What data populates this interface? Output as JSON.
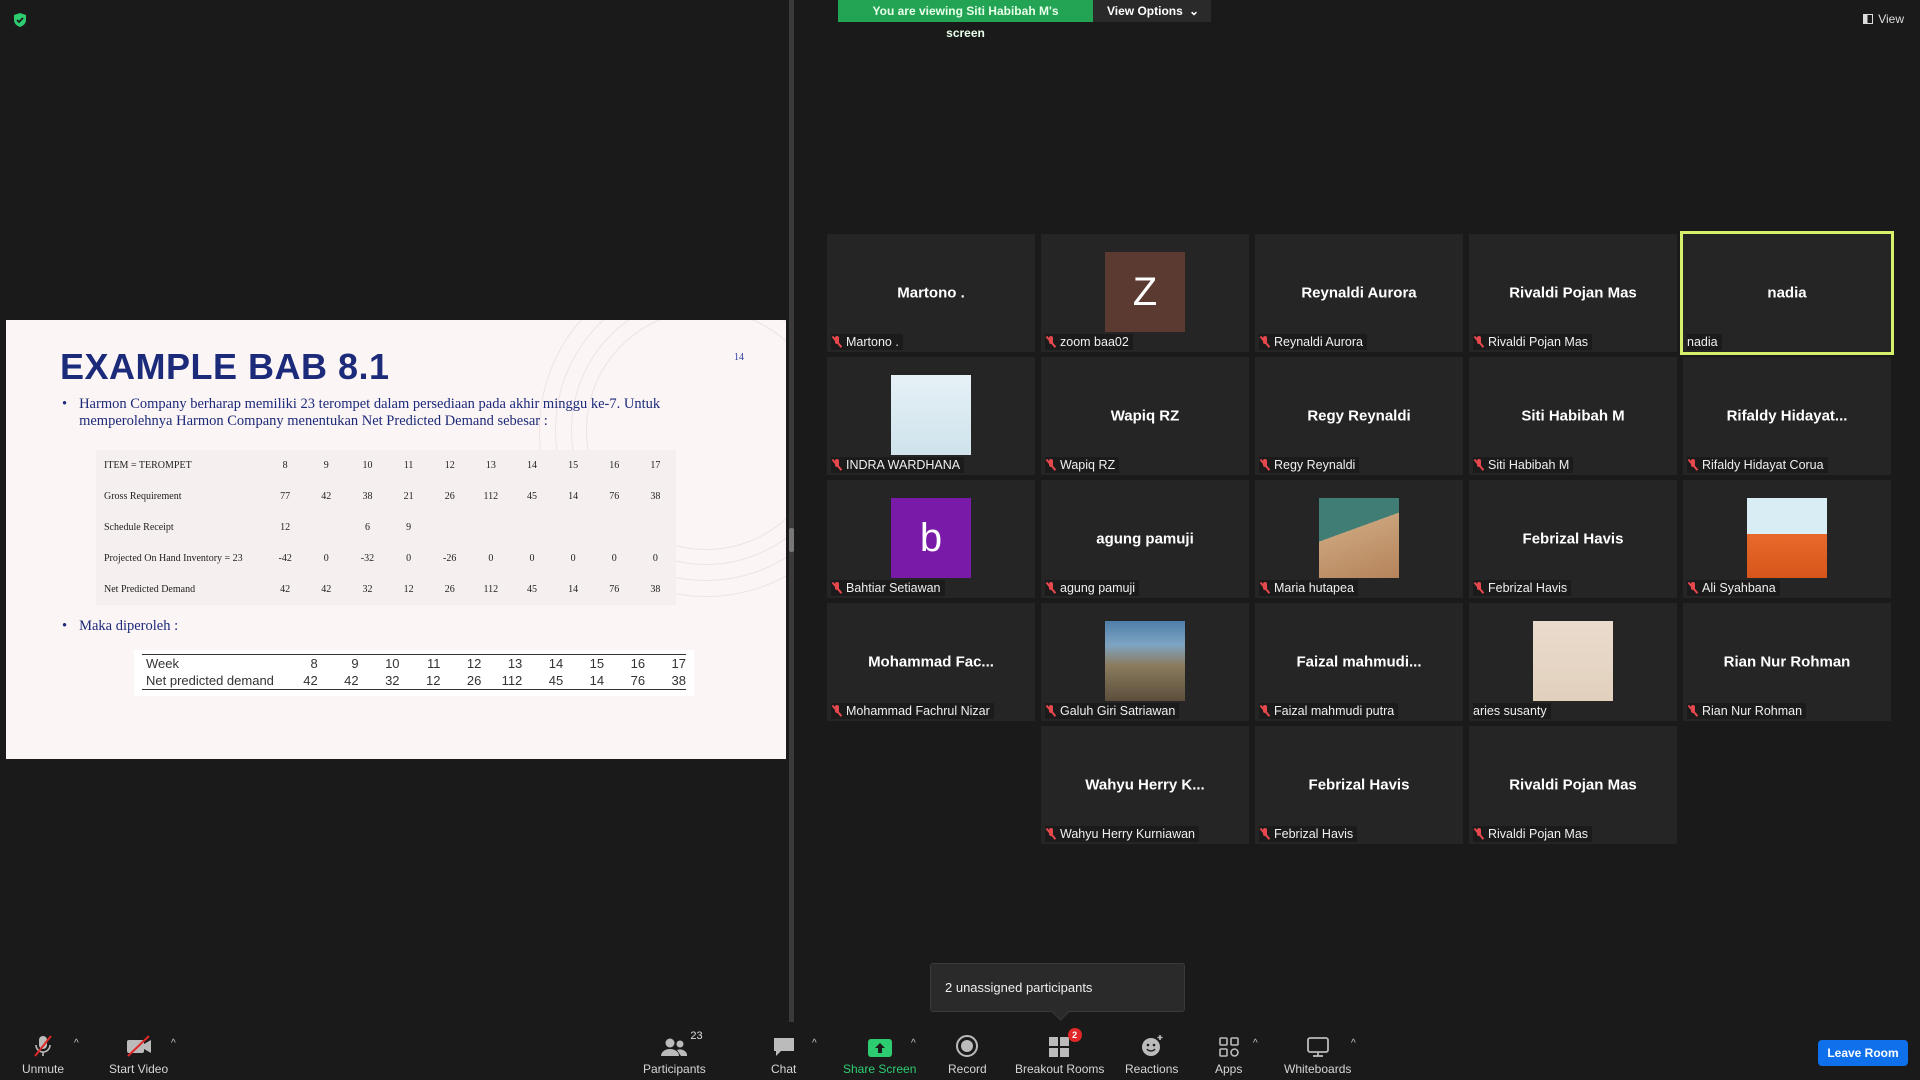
{
  "banner": {
    "viewing": "You are viewing Siti Habibah M's screen",
    "view_options": "View Options",
    "chevron": "⌄"
  },
  "view_button": "View",
  "slide": {
    "title": "EXAMPLE BAB 8.1",
    "page_number": "14",
    "bullet_char": "•",
    "bullet1": "Harmon Company berharap memiliki 23 terompet dalam persediaan pada akhir minggu ke-7. Untuk memperolehnya Harmon Company menentukan Net Predicted Demand sebesar :",
    "table1": {
      "rows": [
        {
          "label": "ITEM = TEROMPET",
          "cells": [
            "8",
            "9",
            "10",
            "11",
            "12",
            "13",
            "14",
            "15",
            "16",
            "17"
          ]
        },
        {
          "label": "Gross Requirement",
          "cells": [
            "77",
            "42",
            "38",
            "21",
            "26",
            "112",
            "45",
            "14",
            "76",
            "38"
          ]
        },
        {
          "label": "Schedule Receipt",
          "cells": [
            "12",
            "",
            "6",
            "9",
            "",
            "",
            "",
            "",
            "",
            ""
          ]
        },
        {
          "label": "Projected On Hand Inventory = 23",
          "cells": [
            "-42",
            "0",
            "-32",
            "0",
            "-26",
            "0",
            "0",
            "0",
            "0",
            "0"
          ]
        },
        {
          "label": "Net Predicted Demand",
          "cells": [
            "42",
            "42",
            "32",
            "12",
            "26",
            "112",
            "45",
            "14",
            "76",
            "38"
          ]
        }
      ]
    },
    "bullet2": "Maka diperoleh :",
    "table2": {
      "rows": [
        {
          "label": "Week",
          "cells": [
            "8",
            "9",
            "10",
            "11",
            "12",
            "13",
            "14",
            "15",
            "16",
            "17"
          ]
        },
        {
          "label": "Net predicted demand",
          "cells": [
            "42",
            "42",
            "32",
            "12",
            "26",
            "112",
            "45",
            "14",
            "76",
            "38"
          ]
        }
      ]
    }
  },
  "tiles": [
    {
      "big": "Martono .",
      "tag": "Martono .",
      "muted": true
    },
    {
      "big": "",
      "avatar_letter": "Z",
      "avatar_color": "#5b3a31",
      "tag": "zoom baa02",
      "muted": true
    },
    {
      "big": "Reynaldi Aurora",
      "tag": "Reynaldi Aurora",
      "muted": true
    },
    {
      "big": "Rivaldi Pojan Mas",
      "tag": "Rivaldi Pojan Mas",
      "muted": true
    },
    {
      "big": "nadia",
      "tag": "nadia",
      "muted": false,
      "active": true
    },
    {
      "big": "",
      "photo": "photo-person1",
      "tag": "INDRA WARDHANA",
      "muted": true
    },
    {
      "big": "Wapiq RZ",
      "tag": "Wapiq RZ",
      "muted": true
    },
    {
      "big": "Regy Reynaldi",
      "tag": "Regy Reynaldi",
      "muted": true
    },
    {
      "big": "Siti Habibah M",
      "tag": "Siti Habibah M",
      "muted": true
    },
    {
      "big": "Rifaldy  Hidayat...",
      "tag": "Rifaldy Hidayat Corua",
      "muted": true
    },
    {
      "big": "",
      "avatar_letter": "b",
      "avatar_color": "#7a1aa8",
      "tag": "Bahtiar Setiawan",
      "muted": true
    },
    {
      "big": "agung pamuji",
      "tag": "agung pamuji",
      "muted": true
    },
    {
      "big": "",
      "photo": "photo-room",
      "tag": "Maria hutapea",
      "muted": true
    },
    {
      "big": "Febrizal Havis",
      "tag": "Febrizal Havis",
      "muted": true
    },
    {
      "big": "",
      "photo": "photo-man-orange",
      "tag": "Ali Syahbana",
      "muted": true
    },
    {
      "big": "Mohammad  Fac...",
      "tag": "Mohammad Fachrul Nizar",
      "muted": true
    },
    {
      "big": "",
      "photo": "photo-mountain",
      "tag": "Galuh Giri Satriawan",
      "muted": true
    },
    {
      "big": "Faizal  mahmudi...",
      "tag": "Faizal mahmudi putra",
      "muted": true
    },
    {
      "big": "",
      "photo": "photo-hijab",
      "tag": "aries susanty",
      "muted": false
    },
    {
      "big": "Rian Nur Rohman",
      "tag": "Rian Nur Rohman",
      "muted": true
    },
    {
      "big": "Wahyu  Herry  K...",
      "tag": "Wahyu Herry Kurniawan",
      "muted": true
    },
    {
      "big": "Febrizal Havis",
      "tag": "Febrizal Havis",
      "muted": true
    },
    {
      "big": "Rivaldi Pojan Mas",
      "tag": "Rivaldi Pojan Mas",
      "muted": true
    }
  ],
  "tooltip": "2 unassigned participants",
  "toolbar": {
    "unmute": "Unmute",
    "start_video": "Start Video",
    "participants": "Participants",
    "participant_count": "23",
    "chat": "Chat",
    "share_screen": "Share Screen",
    "record": "Record",
    "breakout_rooms": "Breakout Rooms",
    "breakout_badge": "2",
    "reactions": "Reactions",
    "apps": "Apps",
    "whiteboards": "Whiteboards",
    "leave": "Leave Room",
    "caret": "^"
  },
  "colors": {
    "accent_green": "#23a455",
    "active_border": "#d7f06b",
    "leave_blue": "#0e71eb",
    "muted_red": "#e5484d"
  }
}
